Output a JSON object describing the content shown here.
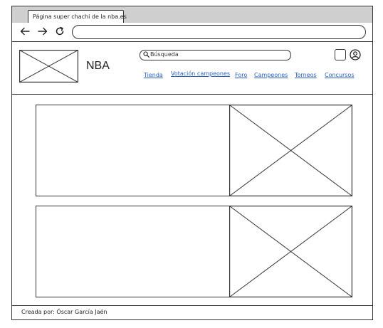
{
  "browser": {
    "tab_title": "Página super chachi de la nba.es",
    "address": "",
    "back_icon": "arrow-left-icon",
    "forward_icon": "arrow-right-icon",
    "reload_icon": "reload-icon"
  },
  "header": {
    "title": "NBA",
    "search_placeholder": "Búsqueda",
    "menu": [
      "Tienda",
      "Votación campeones",
      "Foro",
      "Campeones",
      "Torneos",
      "Concursos"
    ]
  },
  "footer": {
    "credit": "Creada por: Óscar García Jaén"
  },
  "colors": {
    "link": "#2a5fbf",
    "line": "#333333",
    "titlebar": "#cfcfcf"
  }
}
